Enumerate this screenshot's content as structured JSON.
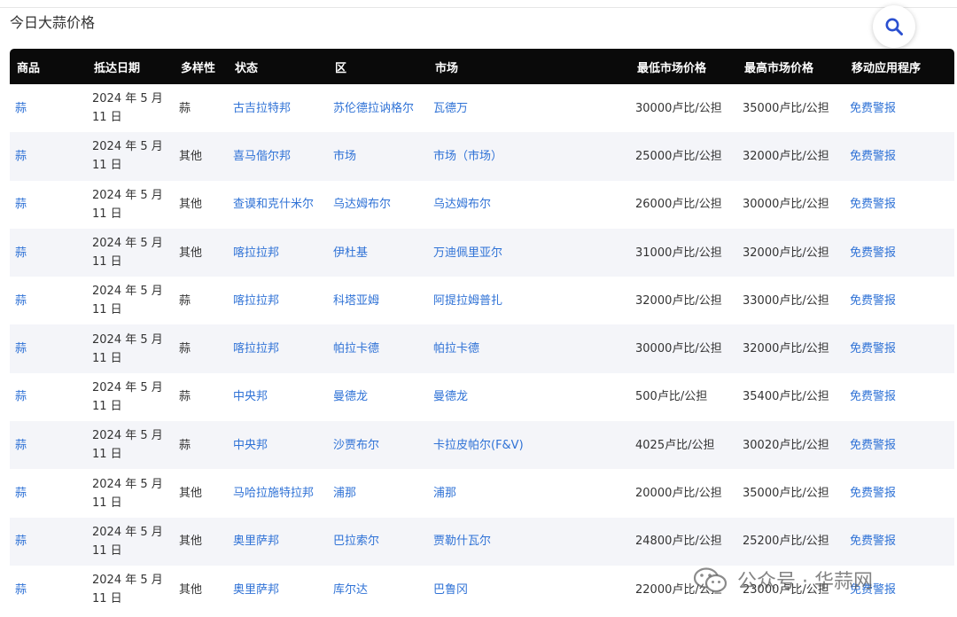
{
  "page": {
    "title": "今日大蒜价格"
  },
  "table": {
    "headers": [
      "商品",
      "抵达日期",
      "多样性",
      "状态",
      "区",
      "市场",
      "最低市场价格",
      "最高市场价格",
      "移动应用程序"
    ],
    "rows": [
      {
        "commodity": "蒜",
        "date_line1": "2024 年 5 月",
        "date_line2": "11 日",
        "variety": "蒜",
        "state": "古吉拉特邦",
        "district": "苏伦德拉讷格尔",
        "market": "瓦德万",
        "min_price": "30000卢比/公担",
        "max_price": "35000卢比/公担",
        "app": "免费警报"
      },
      {
        "commodity": "蒜",
        "date_line1": "2024 年 5 月",
        "date_line2": "11 日",
        "variety": "其他",
        "state": "喜马偕尔邦",
        "district": "市场",
        "market": "市场（市场）",
        "min_price": "25000卢比/公担",
        "max_price": "32000卢比/公担",
        "app": "免费警报"
      },
      {
        "commodity": "蒜",
        "date_line1": "2024 年 5 月",
        "date_line2": "11 日",
        "variety": "其他",
        "state": "查谟和克什米尔",
        "district": "乌达姆布尔",
        "market": "乌达姆布尔",
        "min_price": "26000卢比/公担",
        "max_price": "30000卢比/公担",
        "app": "免费警报"
      },
      {
        "commodity": "蒜",
        "date_line1": "2024 年 5 月",
        "date_line2": "11 日",
        "variety": "其他",
        "state": "喀拉拉邦",
        "district": "伊杜基",
        "market": "万迪佩里亚尔",
        "min_price": "31000卢比/公担",
        "max_price": "32000卢比/公担",
        "app": "免费警报"
      },
      {
        "commodity": "蒜",
        "date_line1": "2024 年 5 月",
        "date_line2": "11 日",
        "variety": "蒜",
        "state": "喀拉拉邦",
        "district": "科塔亚姆",
        "market": "阿提拉姆普扎",
        "min_price": "32000卢比/公担",
        "max_price": "33000卢比/公担",
        "app": "免费警报"
      },
      {
        "commodity": "蒜",
        "date_line1": "2024 年 5 月",
        "date_line2": "11 日",
        "variety": "蒜",
        "state": "喀拉拉邦",
        "district": "帕拉卡德",
        "market": "帕拉卡德",
        "min_price": "30000卢比/公担",
        "max_price": "32000卢比/公担",
        "app": "免费警报"
      },
      {
        "commodity": "蒜",
        "date_line1": "2024 年 5 月",
        "date_line2": "11 日",
        "variety": "蒜",
        "state": "中央邦",
        "district": "曼德龙",
        "market": "曼德龙",
        "min_price": "500卢比/公担",
        "max_price": "35400卢比/公担",
        "app": "免费警报"
      },
      {
        "commodity": "蒜",
        "date_line1": "2024 年 5 月",
        "date_line2": "11 日",
        "variety": "蒜",
        "state": "中央邦",
        "district": "沙贾布尔",
        "market": "卡拉皮帕尔(F&V)",
        "min_price": "4025卢比/公担",
        "max_price": "30020卢比/公担",
        "app": "免费警报"
      },
      {
        "commodity": "蒜",
        "date_line1": "2024 年 5 月",
        "date_line2": "11 日",
        "variety": "其他",
        "state": "马哈拉施特拉邦",
        "district": "浦那",
        "market": "浦那",
        "min_price": "20000卢比/公担",
        "max_price": "35000卢比/公担",
        "app": "免费警报"
      },
      {
        "commodity": "蒜",
        "date_line1": "2024 年 5 月",
        "date_line2": "11 日",
        "variety": "其他",
        "state": "奥里萨邦",
        "district": "巴拉索尔",
        "market": "贾勒什瓦尔",
        "min_price": "24800卢比/公担",
        "max_price": "25200卢比/公担",
        "app": "免费警报"
      },
      {
        "commodity": "蒜",
        "date_line1": "2024 年 5 月",
        "date_line2": "11 日",
        "variety": "其他",
        "state": "奥里萨邦",
        "district": "库尔达",
        "market": "巴鲁冈",
        "min_price": "22000卢比/公担",
        "max_price": "23000卢比/公担",
        "app": "免费警报"
      }
    ]
  },
  "watermark": {
    "text": "公众号 · 华蒜网",
    "icon": "wechat-icon"
  },
  "colors": {
    "header_bg": "#0a0a0a",
    "link": "#2f72d6",
    "row_alt": "#f4f5f9",
    "search_icon": "#2a4fd0"
  },
  "search": {
    "icon": "magnifier-icon"
  }
}
